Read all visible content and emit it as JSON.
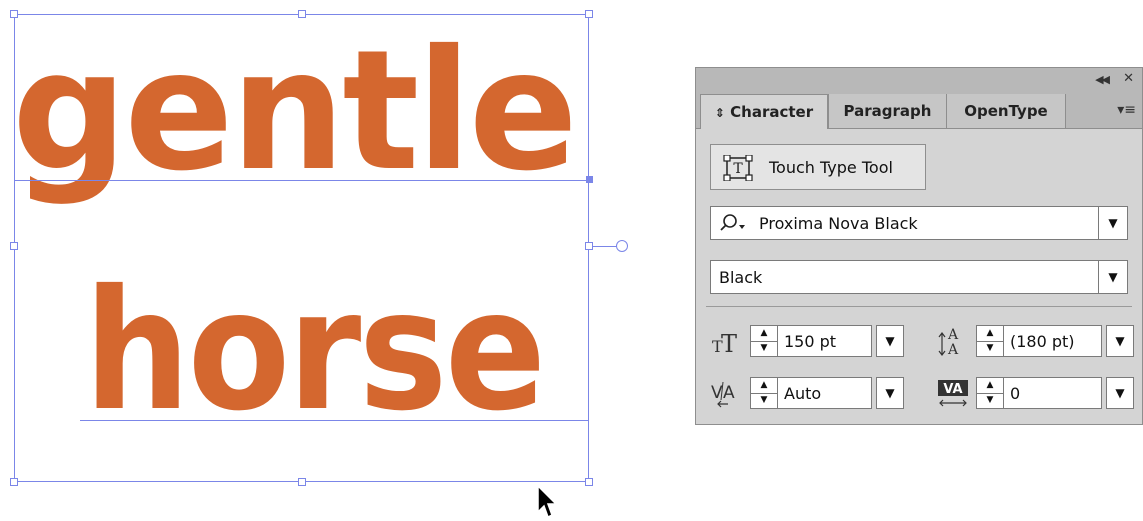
{
  "artboard": {
    "line1": "gentle",
    "line2": "horse",
    "text_color": "#d4672f",
    "selection_color": "#7b86e8"
  },
  "panel": {
    "collapse_icon": "collapse-double-chevron-icon",
    "close_icon": "close-icon",
    "tabs": [
      {
        "label": "Character",
        "active": true
      },
      {
        "label": "Paragraph",
        "active": false
      },
      {
        "label": "OpenType",
        "active": false
      }
    ],
    "touch_type_label": "Touch Type Tool",
    "font_family": "Proxima Nova Black",
    "font_style": "Black",
    "font_size": "150 pt",
    "leading": "(180 pt)",
    "kerning": "Auto",
    "tracking": "0"
  }
}
